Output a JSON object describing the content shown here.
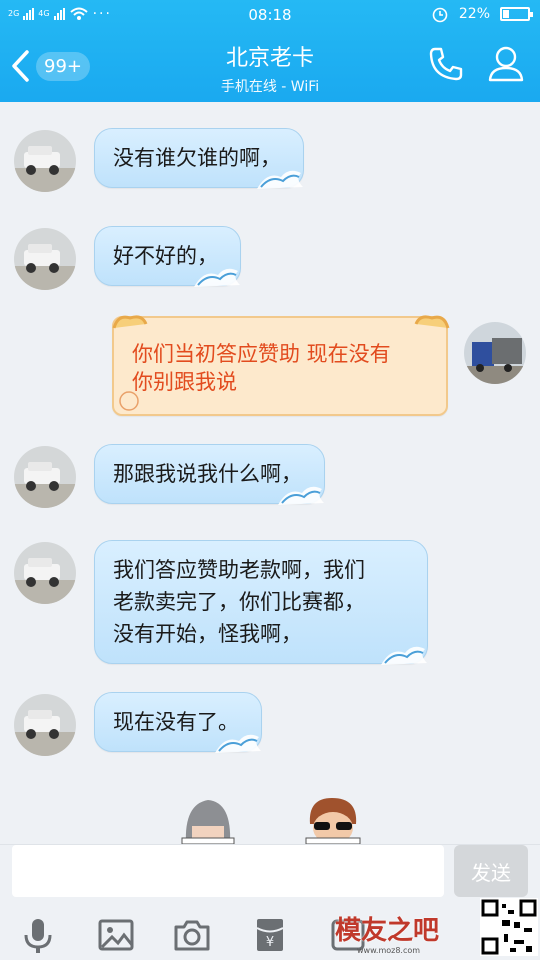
{
  "status_bar": {
    "network_left": "2G",
    "network_right": "4G",
    "time": "08:18",
    "battery": "22%"
  },
  "header": {
    "back_badge": "99+",
    "title": "北京老卡",
    "subtitle": "手机在线 - WiFi",
    "icons": [
      "back-icon",
      "phone-icon",
      "profile-icon"
    ]
  },
  "messages": [
    {
      "side": "left",
      "text": "没有谁欠谁的啊，"
    },
    {
      "side": "left",
      "text": "好不好的，"
    },
    {
      "side": "right",
      "lines": [
        "你们当初答应赞助 现在没有",
        "你别跟我说"
      ]
    },
    {
      "side": "left",
      "text": "那跟我说我什么啊，"
    },
    {
      "side": "left",
      "lines": [
        "我们答应赞助老款啊，我们",
        "老款卖完了，你们比赛都，",
        "没有开始，怪我啊，"
      ]
    },
    {
      "side": "left",
      "text": "现在没有了。"
    }
  ],
  "input": {
    "send_label": "发送",
    "toolbar_icons": [
      "microphone-icon",
      "image-icon",
      "camera-icon",
      "red-packet-icon",
      "emoji-icon"
    ]
  },
  "watermark": {
    "text": "模友之吧",
    "url": "www.moz8.com"
  }
}
